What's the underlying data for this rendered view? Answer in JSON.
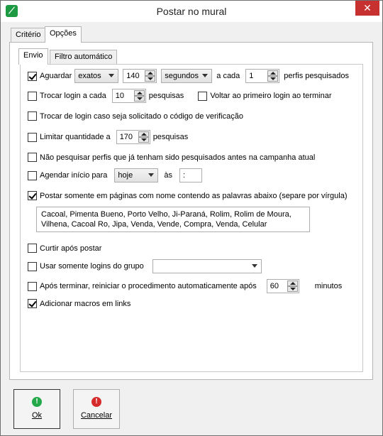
{
  "window": {
    "title": "Postar no mural",
    "close_label": "✕"
  },
  "tabs": [
    {
      "label": "Critério"
    },
    {
      "label": "Opções"
    }
  ],
  "subtabs": [
    {
      "label": "Envio"
    },
    {
      "label": "Filtro automático"
    }
  ],
  "options": {
    "aguardar": {
      "label": "Aguardar",
      "mode": "exatos",
      "amount": "140",
      "unit": "segundos",
      "each_label": "a cada",
      "each_value": "1",
      "suffix": "perfis pesquisados"
    },
    "trocar_login": {
      "label": "Trocar login a cada",
      "value": "10",
      "suffix": "pesquisas",
      "voltar_label": "Voltar ao primeiro login ao terminar"
    },
    "trocar_codigo": {
      "label": "Trocar de login caso seja solicitado o código de verificação"
    },
    "limitar": {
      "label": "Limitar quantidade a",
      "value": "170",
      "suffix": "pesquisas"
    },
    "nao_pesquisar": {
      "label": "Não pesquisar perfis que já tenham sido pesquisados antes na campanha atual"
    },
    "agendar": {
      "label": "Agendar início para",
      "day": "hoje",
      "at_label": "às",
      "time": " :"
    },
    "postar_somente": {
      "label": "Postar somente em páginas com nome contendo as palavras abaixo (separe por vírgula)",
      "keywords": "Cacoal, Pimenta Bueno, Porto Velho, Ji-Paraná, Rolim, Rolim de Moura, Vilhena, Cacoal Ro, Jipa, Venda, Vende, Compra, Venda, Celular"
    },
    "curtir": {
      "label": "Curtir após postar"
    },
    "usar_grupo": {
      "label": "Usar somente logins do grupo",
      "group": ""
    },
    "reiniciar": {
      "label": "Após terminar, reiniciar o procedimento automaticamente após",
      "value": "60",
      "suffix": "minutos"
    },
    "macros": {
      "label": "Adicionar macros em links"
    }
  },
  "buttons": {
    "ok_label": "Ok",
    "cancel_label": "Cancelar"
  },
  "colors": {
    "ok_icon": "#23a84a",
    "cancel_icon": "#d52b2b",
    "close": "#c7312f",
    "app_icon": "#1e9a43"
  }
}
